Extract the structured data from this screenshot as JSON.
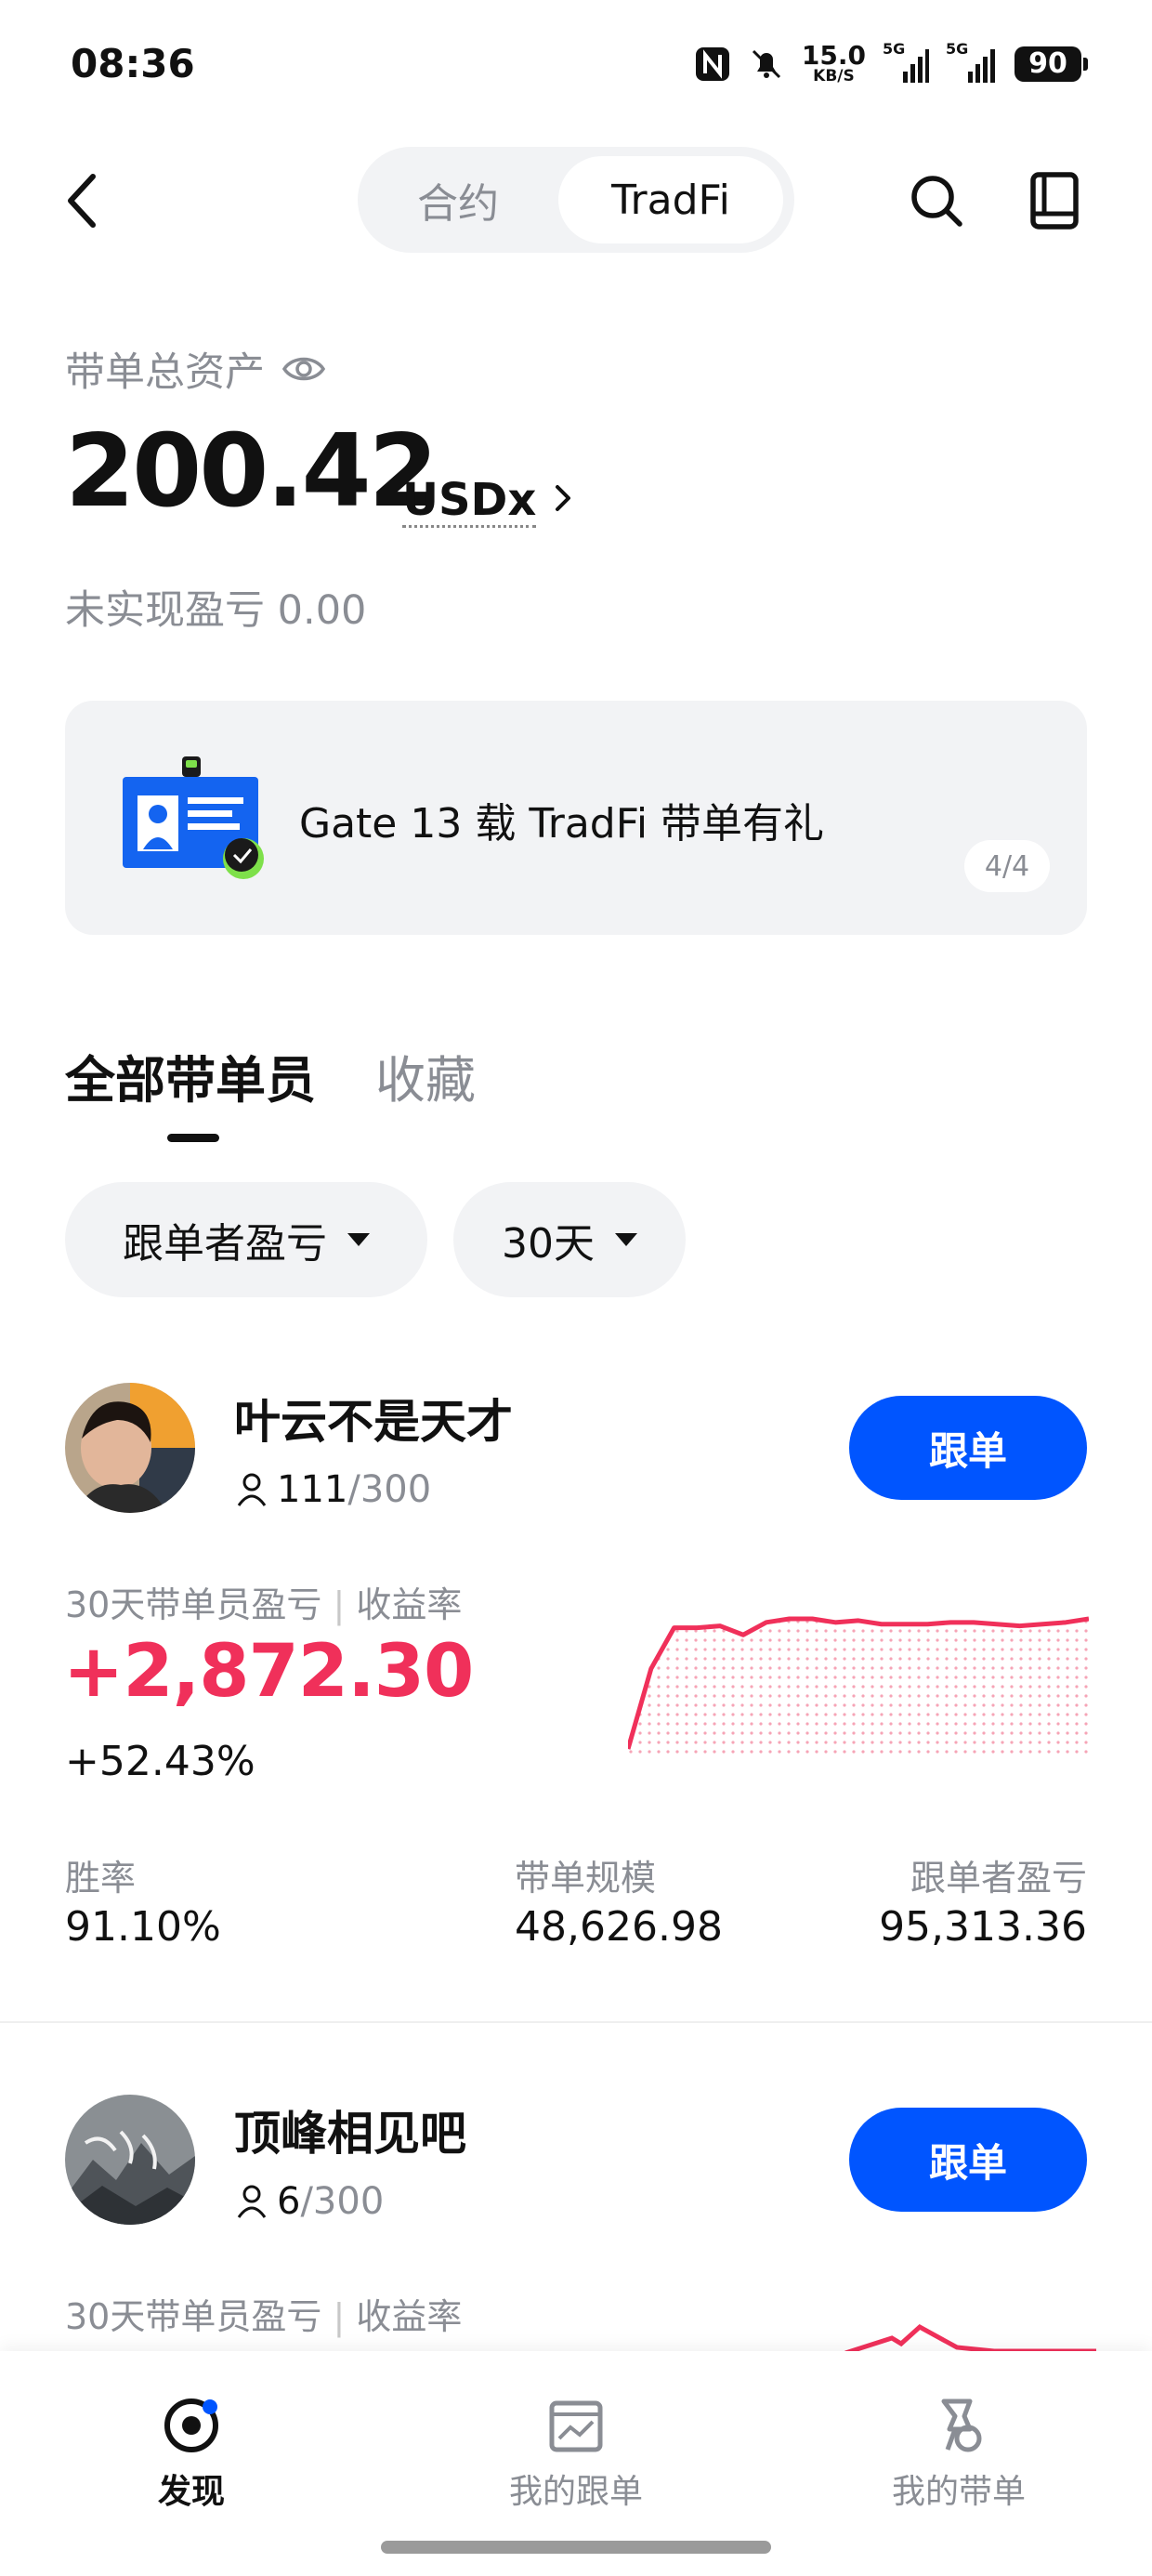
{
  "status_bar": {
    "time": "08:36",
    "net_speed": "15.0",
    "net_unit": "KB/S",
    "sim1": "5G",
    "sim2": "5G",
    "battery": "90"
  },
  "header": {
    "tabs": [
      {
        "label": "合约"
      },
      {
        "label": "TradFi"
      }
    ],
    "active_tab": "TradFi"
  },
  "asset": {
    "label": "带单总资产",
    "value": "200.42",
    "unit": "USDx",
    "unrealized_label": "未实现盈亏",
    "unrealized_value": "0.00"
  },
  "banner": {
    "text": "Gate 13 载 TradFi 带单有礼",
    "pager": "4/4"
  },
  "list_tabs": {
    "all": "全部带单员",
    "favorites": "收藏"
  },
  "filters": {
    "sort": "跟单者盈亏",
    "period": "30天"
  },
  "traders": [
    {
      "name": "叶云不是天才",
      "followers": "111",
      "max_followers": "/300",
      "follow_label": "跟单",
      "pnl_label": "30天带单员盈亏",
      "roi_label": "收益率",
      "pnl": "+2,872.30",
      "roi": "+52.43%",
      "stats": [
        {
          "label": "胜率",
          "value": "91.10%"
        },
        {
          "label": "带单规模",
          "value": "48,626.98"
        },
        {
          "label": "跟单者盈亏",
          "value": "95,313.36"
        }
      ],
      "chart_data": {
        "type": "area",
        "values": [
          10,
          55,
          78,
          78,
          79,
          74,
          81,
          83,
          83,
          81,
          82,
          80,
          80,
          80,
          81,
          81,
          80,
          79,
          80,
          81,
          83
        ]
      }
    },
    {
      "name": "顶峰相见吧",
      "followers": "6",
      "max_followers": "/300",
      "follow_label": "跟单",
      "pnl_label": "30天带单员盈亏",
      "roi_label": "收益率"
    }
  ],
  "bottom_nav": [
    {
      "label": "发现",
      "icon": "discover-icon",
      "active": true
    },
    {
      "label": "我的跟单",
      "icon": "my-copy-icon",
      "active": false
    },
    {
      "label": "我的带单",
      "icon": "my-lead-icon",
      "active": false
    }
  ],
  "colors": {
    "accent": "#0055ff",
    "profit": "#f0305a",
    "muted": "#8a8d94"
  }
}
